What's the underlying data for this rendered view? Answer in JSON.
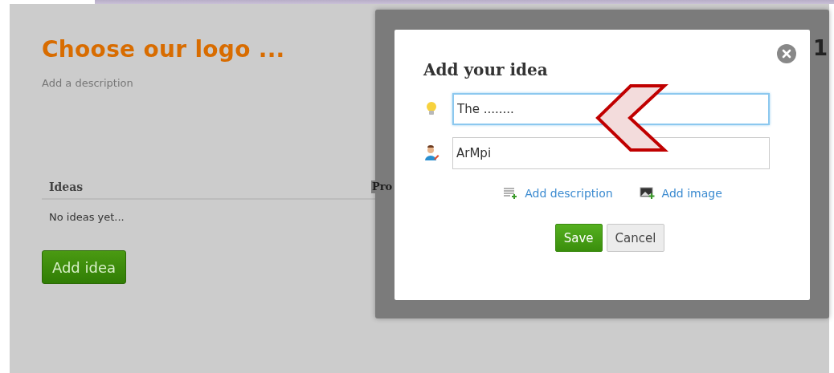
{
  "page": {
    "title": "Choose our logo ...",
    "description": "Add a description",
    "counter": "1",
    "table": {
      "columns": [
        "Ideas",
        "Pro"
      ],
      "empty_text": "No ideas yet..."
    },
    "add_button": "Add idea"
  },
  "dialog": {
    "title": "Add your idea",
    "fields": [
      {
        "kind": "idea",
        "value": "The ........",
        "focused": true
      },
      {
        "kind": "author",
        "value": "ArMpi",
        "focused": false
      }
    ],
    "links": [
      {
        "kind": "description",
        "label": "Add description"
      },
      {
        "kind": "image",
        "label": "Add image"
      }
    ],
    "buttons": [
      {
        "kind": "primary",
        "label": "Save"
      },
      {
        "kind": "secondary",
        "label": "Cancel"
      }
    ]
  }
}
